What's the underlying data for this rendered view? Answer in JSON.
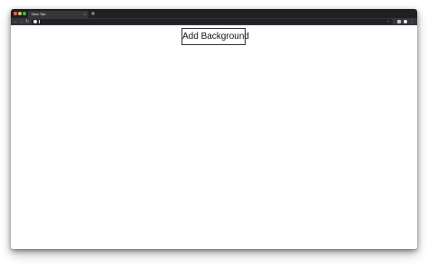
{
  "browser": {
    "tab": {
      "title": "New Tab",
      "close_glyph": "×"
    },
    "new_tab_glyph": "+",
    "nav": {
      "back": "←",
      "forward": "→",
      "reload": "↻"
    },
    "menu_glyph": "⋮",
    "star_glyph": "☆",
    "icons": {
      "back": "arrow-left-icon",
      "forward": "arrow-right-icon",
      "reload": "reload-icon",
      "page": "page-info-icon",
      "bookmark": "star-icon",
      "extensions": "puzzle-icon",
      "profile": "profile-icon",
      "menu": "kebab-menu-icon"
    }
  },
  "page": {
    "button_label": "Add Background"
  }
}
